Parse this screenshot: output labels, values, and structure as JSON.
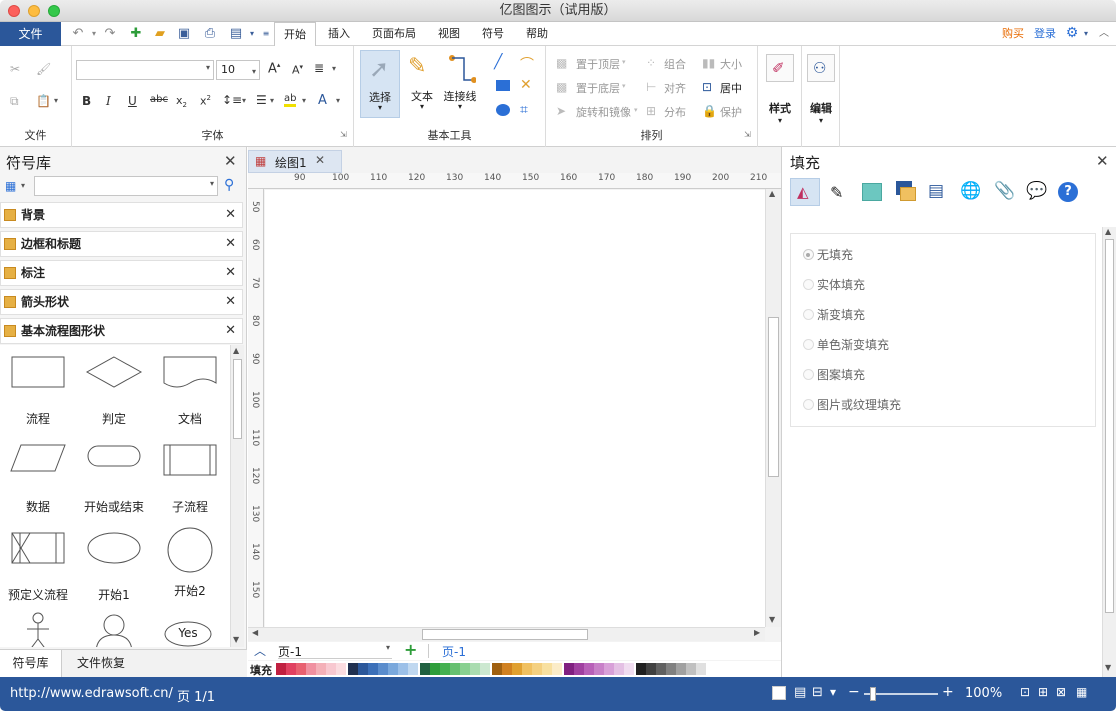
{
  "window": {
    "title": "亿图图示（试用版）"
  },
  "menubar": {
    "file_label": "文件",
    "tabs": [
      "开始",
      "插入",
      "页面布局",
      "视图",
      "符号",
      "帮助"
    ],
    "buy_label": "购买",
    "login_label": "登录"
  },
  "ribbon": {
    "group_labels": {
      "file": "文件",
      "font": "字体",
      "basic_tools": "基本工具",
      "arrange": "排列"
    },
    "font_size": "10",
    "font_name": "",
    "tools": {
      "select": "选择",
      "text": "文本",
      "connector": "连接线"
    },
    "arrange_items": {
      "bring_front": "置于顶层",
      "send_back": "置于底层",
      "rotate": "旋转和镜像",
      "group": "组合",
      "align": "对齐",
      "distribute": "分布",
      "size": "大小",
      "center": "居中",
      "protect": "保护"
    },
    "style_label": "样式",
    "edit_label": "编辑"
  },
  "library": {
    "title": "符号库",
    "search_placeholder": "",
    "sections": [
      "背景",
      "边框和标题",
      "标注",
      "箭头形状",
      "基本流程图形状"
    ],
    "shapes": [
      "流程",
      "判定",
      "文档",
      "数据",
      "开始或结束",
      "子流程",
      "预定义流程",
      "开始1",
      "开始2"
    ],
    "yes_label": "Yes",
    "bottom_tabs": [
      "符号库",
      "文件恢复"
    ]
  },
  "canvas": {
    "doc_tab": "绘图1",
    "h_ruler": [
      "90",
      "100",
      "110",
      "120",
      "130",
      "140",
      "150",
      "160",
      "170",
      "180",
      "190",
      "200",
      "210"
    ],
    "v_ruler": [
      "50",
      "60",
      "70",
      "80",
      "90",
      "100",
      "110",
      "120",
      "130",
      "140",
      "150"
    ],
    "page_selector": "页-1",
    "page_tab": "页-1",
    "fill_label": "填充"
  },
  "fill_panel": {
    "title": "填充",
    "options": [
      "无填充",
      "实体填充",
      "渐变填充",
      "单色渐变填充",
      "图案填充",
      "图片或纹理填充"
    ],
    "selected_index": 0
  },
  "status": {
    "url": "http://www.edrawsoft.cn/",
    "page": "页 1/1",
    "zoom": "100%"
  },
  "colors": {
    "accent": "#2b579a",
    "buy": "#e86a00",
    "login": "#2b6fd6"
  }
}
